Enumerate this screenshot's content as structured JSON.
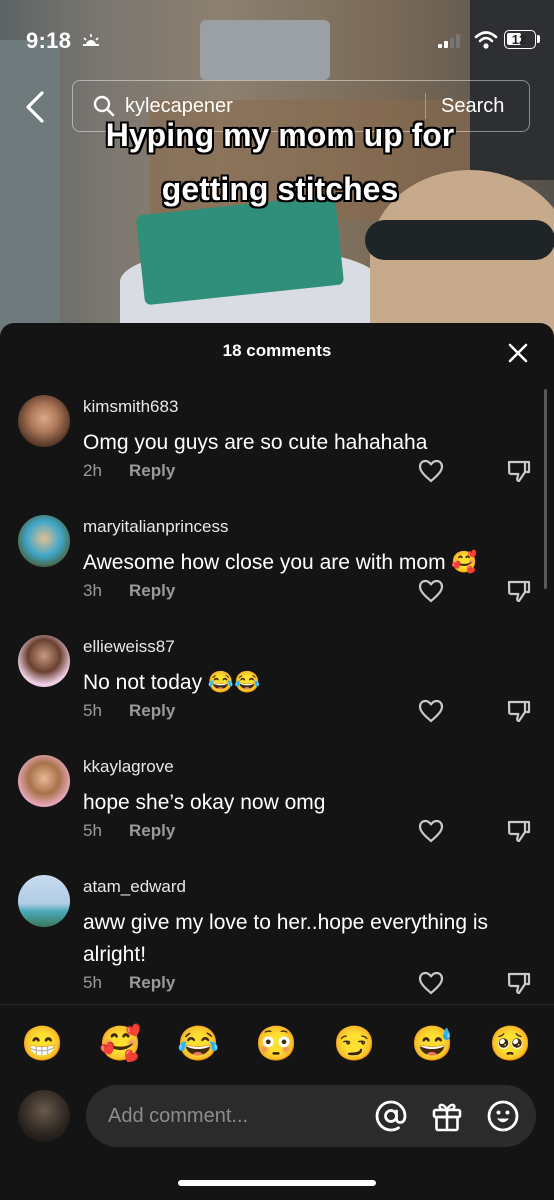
{
  "status_bar": {
    "time": "9:18",
    "battery": "12"
  },
  "search": {
    "query": "kylecapener",
    "button_label": "Search"
  },
  "video": {
    "caption": "Hyping my mom up for getting stitches"
  },
  "comments_panel": {
    "header": "18 comments",
    "reply_label": "Reply",
    "items": [
      {
        "username": "kimsmith683",
        "text": "Omg you guys are so cute hahahaha",
        "time": "2h"
      },
      {
        "username": "maryitalianprincess",
        "text": "Awesome how close you are with mom 🥰",
        "time": "3h"
      },
      {
        "username": "ellieweiss87",
        "text": "No not today 😂😂",
        "time": "5h"
      },
      {
        "username": "kkaylagrove",
        "text": "hope she’s okay now omg",
        "time": "5h"
      },
      {
        "username": "atam_edward",
        "text": "aww give my love to her..hope everything is alright!",
        "time": "5h"
      }
    ]
  },
  "emoji_bar": [
    "😁",
    "🥰",
    "😂",
    "😳",
    "😏",
    "😅",
    "🥺"
  ],
  "composer": {
    "placeholder": "Add comment..."
  },
  "colors": {
    "sheet_bg": "#141414",
    "muted_text": "#9a9a9a",
    "input_bg": "#2b2b2b"
  }
}
